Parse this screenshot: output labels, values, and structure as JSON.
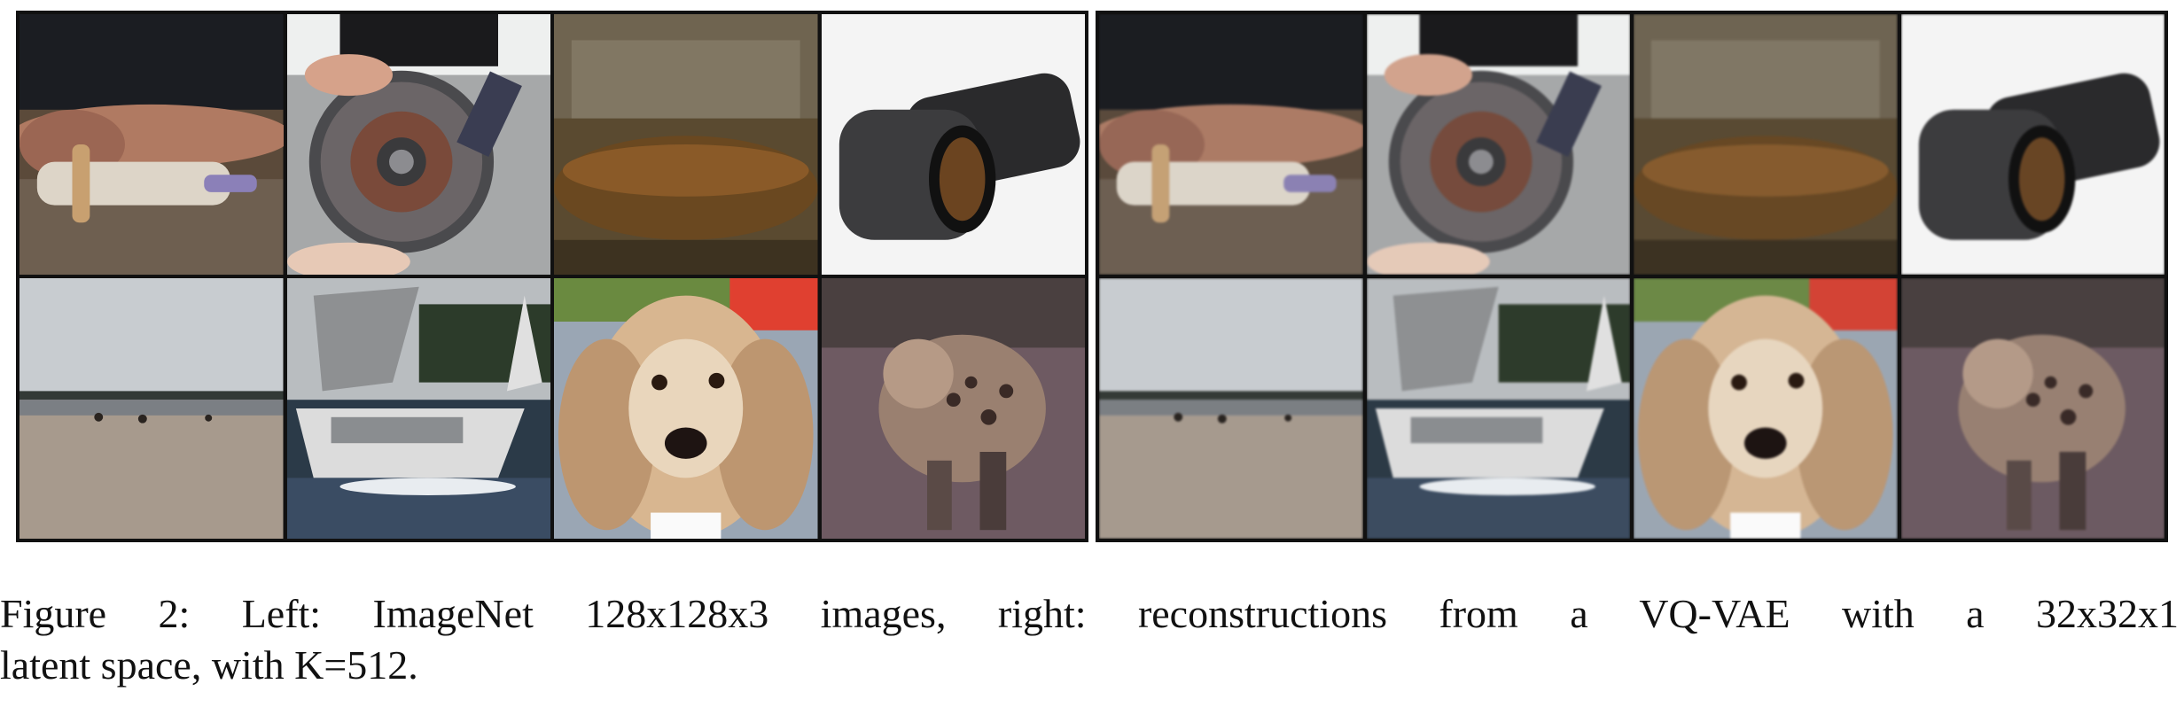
{
  "figure": {
    "caption_line1": "Figure 2: Left: ImageNet 128x128x3 images, right: reconstructions from a VQ-VAE with a 32x32x1",
    "caption_line2": "latent space, with K=512."
  },
  "panels": [
    {
      "side": "left",
      "kind": "original"
    },
    {
      "side": "right",
      "kind": "reconstruction"
    }
  ]
}
